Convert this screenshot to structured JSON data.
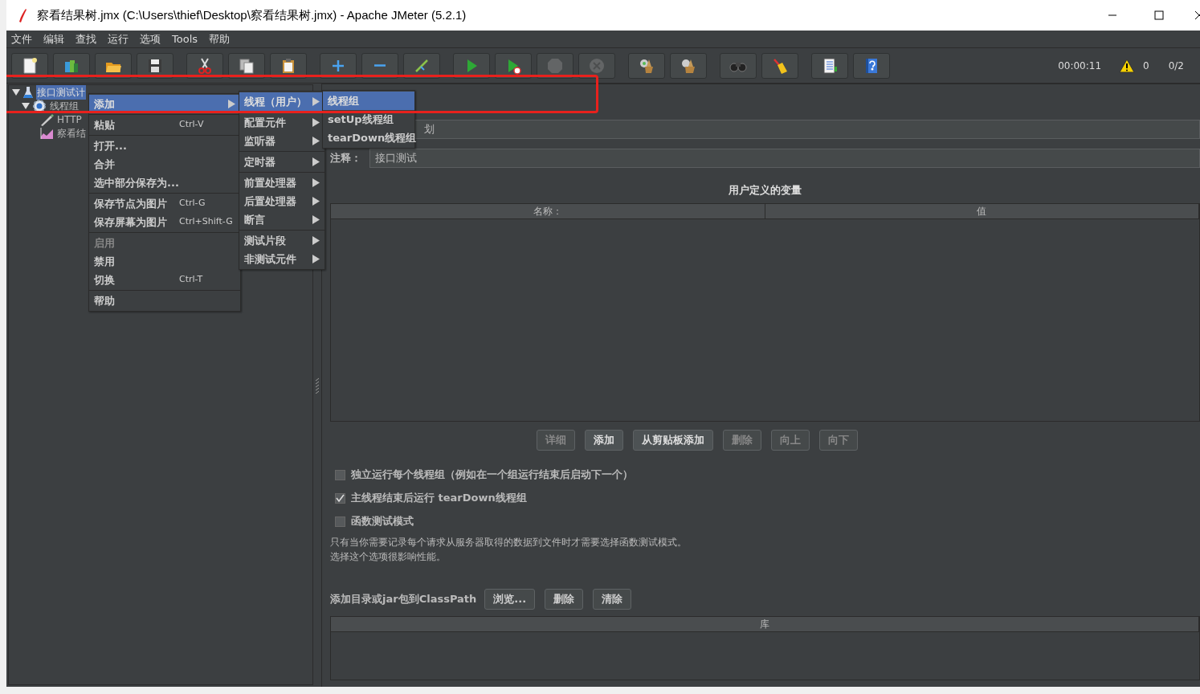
{
  "window": {
    "title": "察看结果树.jmx (C:\\Users\\thief\\Desktop\\察看结果树.jmx) - Apache JMeter (5.2.1)"
  },
  "menu_bar": [
    {
      "label": "文件"
    },
    {
      "label": "编辑"
    },
    {
      "label": "查找"
    },
    {
      "label": "运行"
    },
    {
      "label": "选项"
    },
    {
      "label": "Tools"
    },
    {
      "label": "帮助"
    }
  ],
  "toolbar": {
    "groups": [
      [
        {
          "kind": "new",
          "disabled": false
        },
        {
          "kind": "templates",
          "disabled": false
        },
        {
          "kind": "open",
          "disabled": false
        },
        {
          "kind": "save",
          "disabled": false
        }
      ],
      [
        {
          "kind": "cut",
          "disabled": false
        },
        {
          "kind": "copy",
          "disabled": false
        },
        {
          "kind": "paste",
          "disabled": false
        }
      ],
      [
        {
          "kind": "expand",
          "disabled": false
        },
        {
          "kind": "collapse",
          "disabled": false
        },
        {
          "kind": "toggle",
          "disabled": false
        }
      ],
      [
        {
          "kind": "start",
          "disabled": false
        },
        {
          "kind": "start_no_pause",
          "disabled": false
        },
        {
          "kind": "stop",
          "disabled": true
        },
        {
          "kind": "shutdown",
          "disabled": true
        }
      ],
      [
        {
          "kind": "clear",
          "disabled": false
        },
        {
          "kind": "clear_all",
          "disabled": false
        }
      ],
      [
        {
          "kind": "search",
          "disabled": false
        },
        {
          "kind": "reset_search",
          "disabled": false
        }
      ],
      [
        {
          "kind": "function_helper",
          "disabled": false
        },
        {
          "kind": "help",
          "disabled": false
        }
      ]
    ],
    "timer": "00:00:11",
    "warnings": "0",
    "threads": "0/2"
  },
  "tree": [
    {
      "label": "接口测试计",
      "kind": "test_plan",
      "selected": true,
      "expanded": true,
      "children": [
        {
          "label": "线程组",
          "kind": "thread_group",
          "selected": false,
          "expanded": true,
          "children": [
            {
              "label": "HTTP",
              "kind": "sampler",
              "selected": false
            },
            {
              "label": "察看结",
              "kind": "listener",
              "selected": false
            }
          ]
        }
      ]
    }
  ],
  "context_menu": {
    "groups": [
      [
        {
          "label": "添加",
          "selected": true,
          "disabled": false,
          "submenu": true
        }
      ],
      [
        {
          "label": "粘贴",
          "shortcut": "Ctrl-V",
          "selected": false,
          "disabled": false
        }
      ],
      [
        {
          "label": "打开...",
          "selected": false,
          "disabled": false
        },
        {
          "label": "合并",
          "selected": false,
          "disabled": false
        },
        {
          "label": "选中部分保存为...",
          "selected": false,
          "disabled": false
        }
      ],
      [
        {
          "label": "保存节点为图片",
          "shortcut": "Ctrl-G",
          "selected": false,
          "disabled": false
        },
        {
          "label": "保存屏幕为图片",
          "shortcut": "Ctrl+Shift-G",
          "selected": false,
          "disabled": false
        }
      ],
      [
        {
          "label": "启用",
          "selected": false,
          "disabled": true
        },
        {
          "label": "禁用",
          "selected": false,
          "disabled": false
        },
        {
          "label": "切换",
          "shortcut": "Ctrl-T",
          "selected": false,
          "disabled": false
        }
      ],
      [
        {
          "label": "帮助",
          "selected": false,
          "disabled": false
        }
      ]
    ]
  },
  "add_submenu": {
    "groups": [
      [
        {
          "label": "线程（用户）",
          "selected": true,
          "submenu": true
        }
      ],
      [
        {
          "label": "配置元件",
          "selected": false,
          "submenu": true
        },
        {
          "label": "监听器",
          "selected": false,
          "submenu": true
        }
      ],
      [
        {
          "label": "定时器",
          "selected": false,
          "submenu": true
        }
      ],
      [
        {
          "label": "前置处理器",
          "selected": false,
          "submenu": true
        },
        {
          "label": "后置处理器",
          "selected": false,
          "submenu": true
        },
        {
          "label": "断言",
          "selected": false,
          "submenu": true
        }
      ],
      [
        {
          "label": "测试片段",
          "selected": false,
          "submenu": true
        },
        {
          "label": "非测试元件",
          "selected": false,
          "submenu": true
        }
      ]
    ]
  },
  "threads_submenu": {
    "groups": [
      [
        {
          "label": "线程组",
          "selected": true
        },
        {
          "label": "setUp线程组",
          "selected": false
        },
        {
          "label": "tearDown线程组",
          "selected": false
        }
      ]
    ]
  },
  "form": {
    "name_field": {
      "value": "划"
    },
    "comment": {
      "label": "注释：",
      "value": "接口测试"
    },
    "variables": {
      "title": "用户定义的变量",
      "columns": [
        "名称：",
        "值"
      ]
    },
    "buttons": [
      {
        "label": "详细",
        "disabled": true
      },
      {
        "label": "添加",
        "disabled": false
      },
      {
        "label": "从剪贴板添加",
        "disabled": false
      },
      {
        "label": "删除",
        "disabled": true
      },
      {
        "label": "向上",
        "disabled": true
      },
      {
        "label": "向下",
        "disabled": true
      }
    ],
    "options": [
      {
        "label": "独立运行每个线程组（例如在一个组运行结束后启动下一个）",
        "checked": false
      },
      {
        "label": "主线程结束后运行 tearDown线程组",
        "checked": true
      },
      {
        "label": "函数测试模式",
        "checked": false
      }
    ],
    "note": [
      "只有当你需要记录每个请求从服务器取得的数据到文件时才需要选择函数测试模式。",
      "选择这个选项很影响性能。"
    ],
    "classpath": {
      "label": "添加目录或jar包到ClassPath",
      "buttons": [
        {
          "label": "浏览...",
          "disabled": false
        },
        {
          "label": "删除",
          "disabled": false
        },
        {
          "label": "清除",
          "disabled": false
        }
      ],
      "columns": [
        "库"
      ]
    }
  }
}
